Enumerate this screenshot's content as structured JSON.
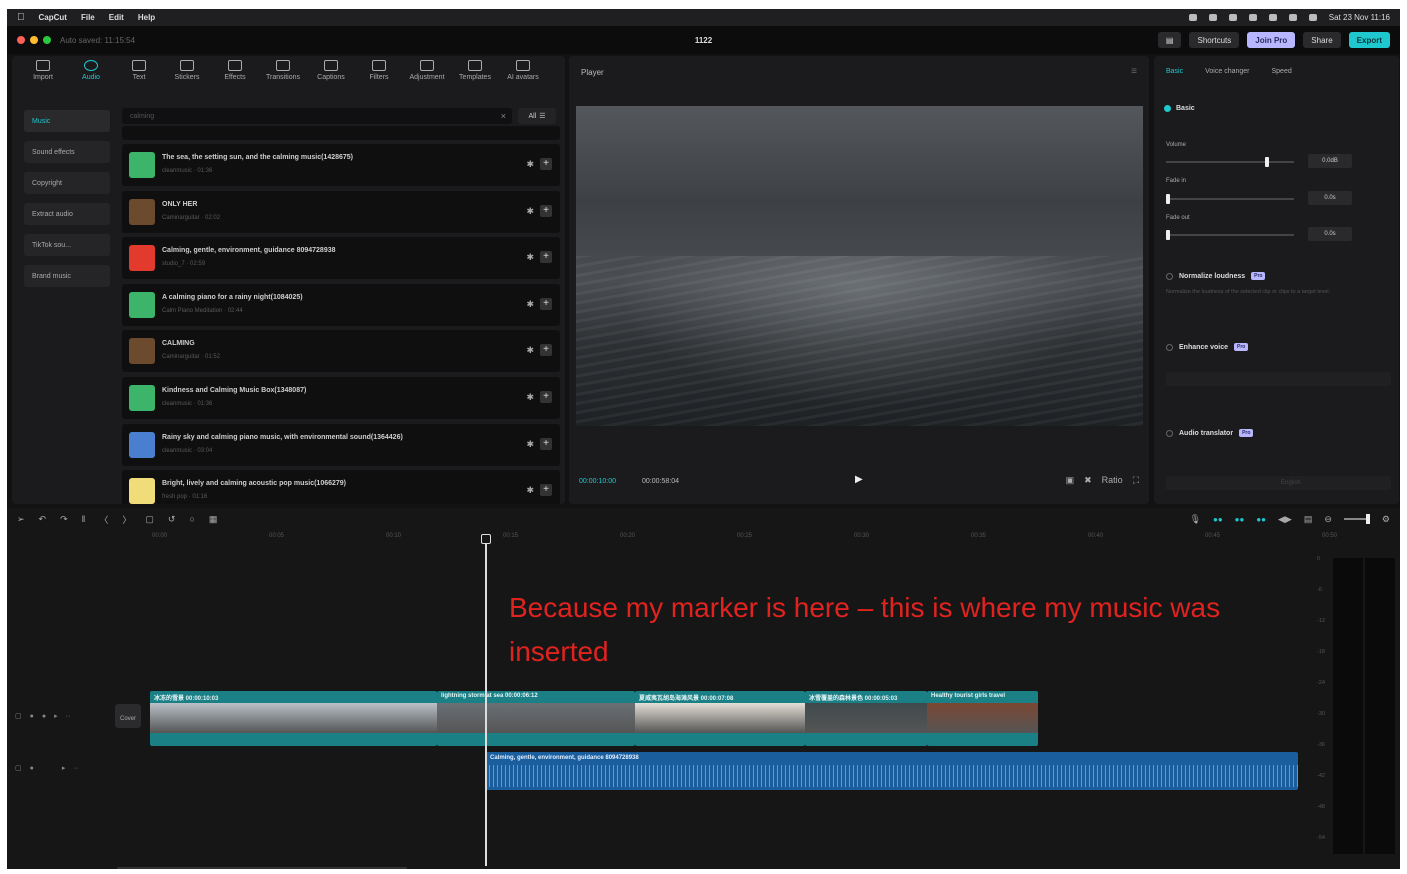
{
  "menubar": {
    "app": "CapCut",
    "items": [
      "File",
      "Edit",
      "Help"
    ],
    "clock": "Sat 23 Nov 11:16"
  },
  "titlebar": {
    "autosave": "Auto saved: 11:15:54",
    "project": "1122",
    "shortcuts": "Shortcuts",
    "join_pro": "Join Pro",
    "share": "Share",
    "export": "Export"
  },
  "media": {
    "tools": [
      {
        "label": "Import",
        "icon": "import-icon"
      },
      {
        "label": "Audio",
        "icon": "audio-icon"
      },
      {
        "label": "Text",
        "icon": "text-icon"
      },
      {
        "label": "Stickers",
        "icon": "stickers-icon"
      },
      {
        "label": "Effects",
        "icon": "effects-icon"
      },
      {
        "label": "Transitions",
        "icon": "transitions-icon"
      },
      {
        "label": "Captions",
        "icon": "captions-icon"
      },
      {
        "label": "Filters",
        "icon": "filters-icon"
      },
      {
        "label": "Adjustment",
        "icon": "adjustment-icon"
      },
      {
        "label": "Templates",
        "icon": "templates-icon"
      },
      {
        "label": "AI avatars",
        "icon": "ai-avatars-icon"
      }
    ],
    "categories": [
      "Music",
      "Sound effects",
      "Copyright",
      "Extract audio",
      "TikTok sou...",
      "Brand music"
    ],
    "search_placeholder": "calming",
    "filter": "All",
    "tracks": [
      {
        "title": "The sea, the setting sun, and the calming music(1428675)",
        "meta": "cleanmusic · 01:36",
        "color": "#3cb56a"
      },
      {
        "title": "ONLY HER",
        "meta": "Caminarguitar · 02:02",
        "color": "#6b4a2e"
      },
      {
        "title": "Calming, gentle, environment, guidance 8094728938",
        "meta": "studio_7 · 02:59",
        "color": "#e23a2c"
      },
      {
        "title": "A calming piano for a rainy night(1084025)",
        "meta": "Calm Piano Meditation · 02:44",
        "color": "#3cb56a"
      },
      {
        "title": "CALMING",
        "meta": "Caminarguitar · 01:52",
        "color": "#6b4a2e"
      },
      {
        "title": "Kindness and Calming Music Box(1348087)",
        "meta": "cleanmusic · 01:36",
        "color": "#3cb56a"
      },
      {
        "title": "Rainy sky and calming piano music, with environmental sound(1364426)",
        "meta": "cleanmusic · 03:04",
        "color": "#4a7fd0"
      },
      {
        "title": "Bright, lively and calming acoustic pop music(1066279)",
        "meta": "fresh pop · 01:16",
        "color": "#f1dc7a"
      }
    ]
  },
  "player": {
    "title": "Player",
    "current_time": "00:00:10:00",
    "total_time": "00:00:58:04",
    "ratio": "Ratio"
  },
  "props": {
    "tabs": [
      "Basic",
      "Voice changer",
      "Speed"
    ],
    "basic": "Basic",
    "volume_label": "Volume",
    "volume_value": "0.0dB",
    "volume_level": 0.8,
    "fade_in_label": "Fade in",
    "fade_in_value": "0.0s",
    "fade_out_label": "Fade out",
    "fade_out_value": "0.0s",
    "normalize": "Normalize loudness",
    "normalize_desc": "Normalize the loudness of the selected clip or clips to a target level.",
    "enhance": "Enhance voice",
    "translator": "Audio translator",
    "translator_target": "English",
    "pro": "Pro"
  },
  "timeline": {
    "ruler": [
      "00:00",
      "00:05",
      "00:10",
      "00:15",
      "00:20",
      "00:25",
      "00:30",
      "00:35",
      "00:40",
      "00:45",
      "00:50"
    ],
    "cover": "Cover",
    "video_clips": [
      {
        "label": "冰冻的雪景 00:00:10:03",
        "tint": "#b9c1c7"
      },
      {
        "label": "lightning storm at sea 00:00:06:12",
        "tint": "#6a7075"
      },
      {
        "label": "夏威夷瓦胡岛海滩风景 00:00:07:08",
        "tint": "#e4e0d6"
      },
      {
        "label": "冰雪覆盖的森林景色 00:00:05:03",
        "tint": "#3f4a4d"
      },
      {
        "label": "Healthy tourist girls travel",
        "tint": "#7b4733"
      }
    ],
    "audio_clip": "Calming, gentle, environment, guidance 8094728938",
    "annotation": "Because my marker is here – this is where my music was inserted",
    "meter_scale": [
      "0",
      "-6",
      "-12",
      "-18",
      "-24",
      "-30",
      "-36",
      "-42",
      "-48",
      "-54"
    ]
  }
}
